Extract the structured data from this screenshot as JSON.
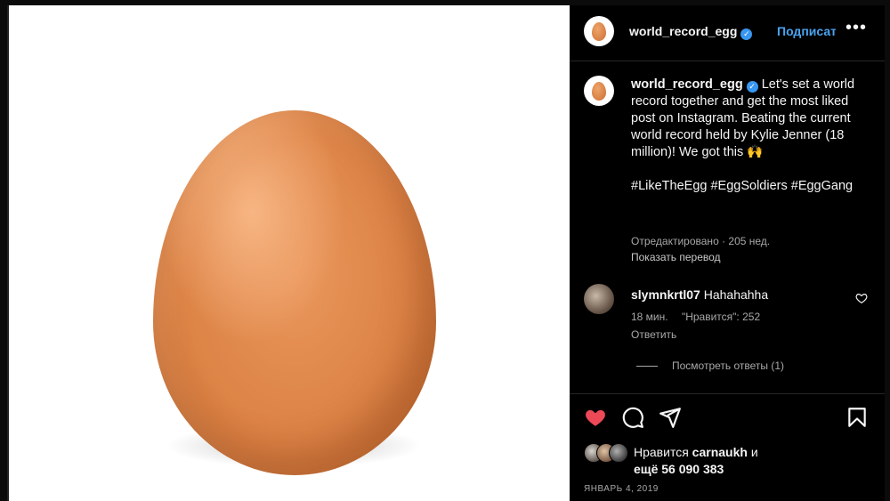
{
  "post": {
    "username": "world_record_egg",
    "follow_label": "Подписаться",
    "more_label": "•••",
    "caption_text": "Let's set a world record together and get the most liked post on Instagram. Beating the current world record held by Kylie Jenner (18 million)! We got this 🙌",
    "hashtags": "#LikeTheEgg #EggSoldiers #EggGang",
    "edited_meta": "Отредактировано · 205 нед.",
    "translate_label": "Показать перевод"
  },
  "comment": {
    "username": "slymnkrtl07",
    "text": "Hahahahha",
    "time": "18 мин.",
    "likes": "\"Нравится\": 252",
    "reply_label": "Ответить",
    "view_replies_label": "Посмотреть ответы (1)"
  },
  "actions": {
    "like_icon": "heart-filled-icon",
    "comment_icon": "comment-icon",
    "share_icon": "paper-plane-icon",
    "save_icon": "bookmark-icon"
  },
  "likes": {
    "line1_prefix": "Нравится",
    "line1_user": "carnaukh",
    "line1_suffix": "и",
    "line2": "ещё 56 090 383"
  },
  "date": "ЯНВАРЬ 4, 2019",
  "colors": {
    "accent": "#4aa3f0",
    "like": "#ed4956",
    "verified": "#3897f0"
  }
}
